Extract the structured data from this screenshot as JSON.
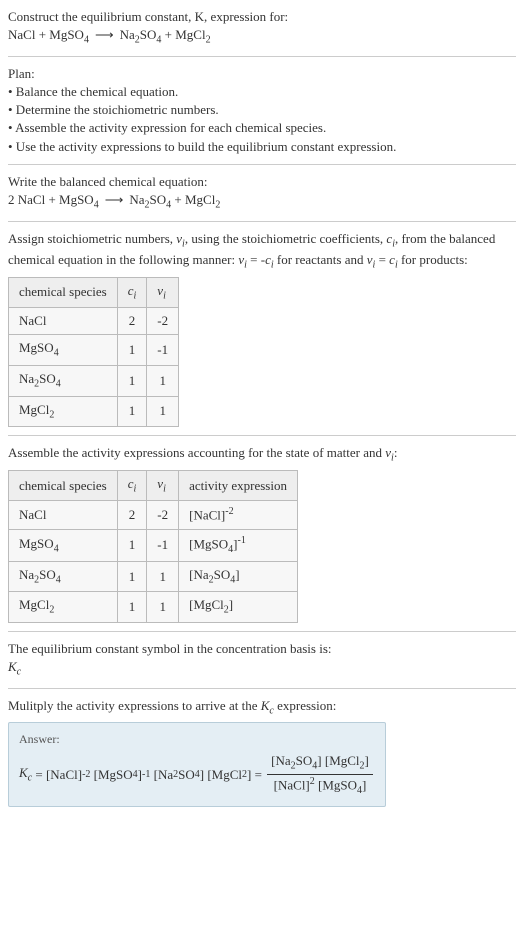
{
  "intro": {
    "line1": "Construct the equilibrium constant, K, expression for:",
    "equation_lhs": "NaCl + MgSO",
    "equation_rhs": "Na₂SO₄ + MgCl₂"
  },
  "plan": {
    "heading": "Plan:",
    "items": [
      "• Balance the chemical equation.",
      "• Determine the stoichiometric numbers.",
      "• Assemble the activity expression for each chemical species.",
      "• Use the activity expressions to build the equilibrium constant expression."
    ]
  },
  "balanced": {
    "heading": "Write the balanced chemical equation:"
  },
  "stoich": {
    "heading_part1": "Assign stoichiometric numbers, ν",
    "heading_part2": ", using the stoichiometric coefficients, c",
    "heading_part3": ", from the balanced chemical equation in the following manner: ν",
    "heading_part4": " = -c",
    "heading_part5": " for reactants and ν",
    "heading_part6": " = c",
    "heading_part7": " for products:",
    "table": {
      "headers": [
        "chemical species",
        "cᵢ",
        "νᵢ"
      ],
      "rows": [
        [
          "NaCl",
          "2",
          "-2"
        ],
        [
          "MgSO₄",
          "1",
          "-1"
        ],
        [
          "Na₂SO₄",
          "1",
          "1"
        ],
        [
          "MgCl₂",
          "1",
          "1"
        ]
      ]
    }
  },
  "activity": {
    "heading": "Assemble the activity expressions accounting for the state of matter and νᵢ:",
    "table": {
      "headers": [
        "chemical species",
        "cᵢ",
        "νᵢ",
        "activity expression"
      ],
      "rows": [
        {
          "sp": "NaCl",
          "c": "2",
          "v": "-2",
          "ae": "[NaCl]⁻²"
        },
        {
          "sp": "MgSO₄",
          "c": "1",
          "v": "-1",
          "ae": "[MgSO₄]⁻¹"
        },
        {
          "sp": "Na₂SO₄",
          "c": "1",
          "v": "1",
          "ae": "[Na₂SO₄]"
        },
        {
          "sp": "MgCl₂",
          "c": "1",
          "v": "1",
          "ae": "[MgCl₂]"
        }
      ]
    }
  },
  "symbol": {
    "line1": "The equilibrium constant symbol in the concentration basis is:",
    "line2": "K_c"
  },
  "multiply": {
    "heading": "Mulitply the activity expressions to arrive at the K_c expression:"
  },
  "answer": {
    "label": "Answer:"
  },
  "chart_data": {
    "type": "table",
    "title": "Stoichiometric numbers and activity expressions",
    "tables": [
      {
        "headers": [
          "chemical species",
          "c_i",
          "nu_i"
        ],
        "rows": [
          [
            "NaCl",
            2,
            -2
          ],
          [
            "MgSO4",
            1,
            -1
          ],
          [
            "Na2SO4",
            1,
            1
          ],
          [
            "MgCl2",
            1,
            1
          ]
        ]
      },
      {
        "headers": [
          "chemical species",
          "c_i",
          "nu_i",
          "activity expression"
        ],
        "rows": [
          [
            "NaCl",
            2,
            -2,
            "[NaCl]^-2"
          ],
          [
            "MgSO4",
            1,
            -1,
            "[MgSO4]^-1"
          ],
          [
            "Na2SO4",
            1,
            1,
            "[Na2SO4]"
          ],
          [
            "MgCl2",
            1,
            1,
            "[MgCl2]"
          ]
        ]
      }
    ],
    "balanced_equation": "2 NaCl + MgSO4 -> Na2SO4 + MgCl2",
    "Kc_expression": "Kc = [NaCl]^-2 [MgSO4]^-1 [Na2SO4] [MgCl2] = ([Na2SO4][MgCl2]) / ([NaCl]^2 [MgSO4])"
  }
}
